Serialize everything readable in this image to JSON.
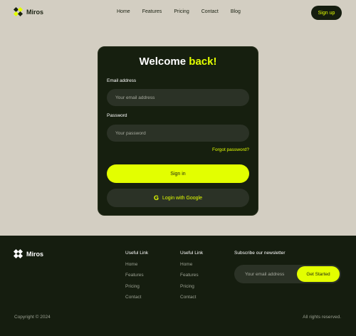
{
  "brand": {
    "name": "Miros",
    "icon": "four-diamond-logo-icon",
    "logo_color": "#e3ff00",
    "logo_dark": "#1b2212"
  },
  "nav": {
    "items": [
      "Home",
      "Features",
      "Pricing",
      "Contact",
      "Blog"
    ],
    "signup_label": "Sign up"
  },
  "login": {
    "title_main": "Welcome",
    "title_accent": "back!",
    "email_label": "Email address",
    "email_placeholder": "Your email address",
    "password_label": "Password",
    "password_placeholder": "Your password",
    "forgot_label": "Forgot password?",
    "signin_label": "Sign in",
    "google_label": "Login with Google",
    "google_icon": "google-g-icon"
  },
  "footer": {
    "brand_name": "Miros",
    "columns": [
      {
        "title": "Useful Link",
        "links": [
          "Home",
          "Features",
          "Pricing",
          "Contact"
        ]
      },
      {
        "title": "Useful Link",
        "links": [
          "Home",
          "Features",
          "Pricing",
          "Contact"
        ]
      }
    ],
    "newsletter_title": "Subscribe our newsletter",
    "newsletter_placeholder": "Your email address",
    "newsletter_button": "Get Started",
    "copyright": "Copyright © 2024",
    "rights": "All rights reserved."
  },
  "colors": {
    "accent": "#e3ff00",
    "dark": "#151d0f",
    "background": "#d3cec2",
    "field": "#2b3226"
  }
}
